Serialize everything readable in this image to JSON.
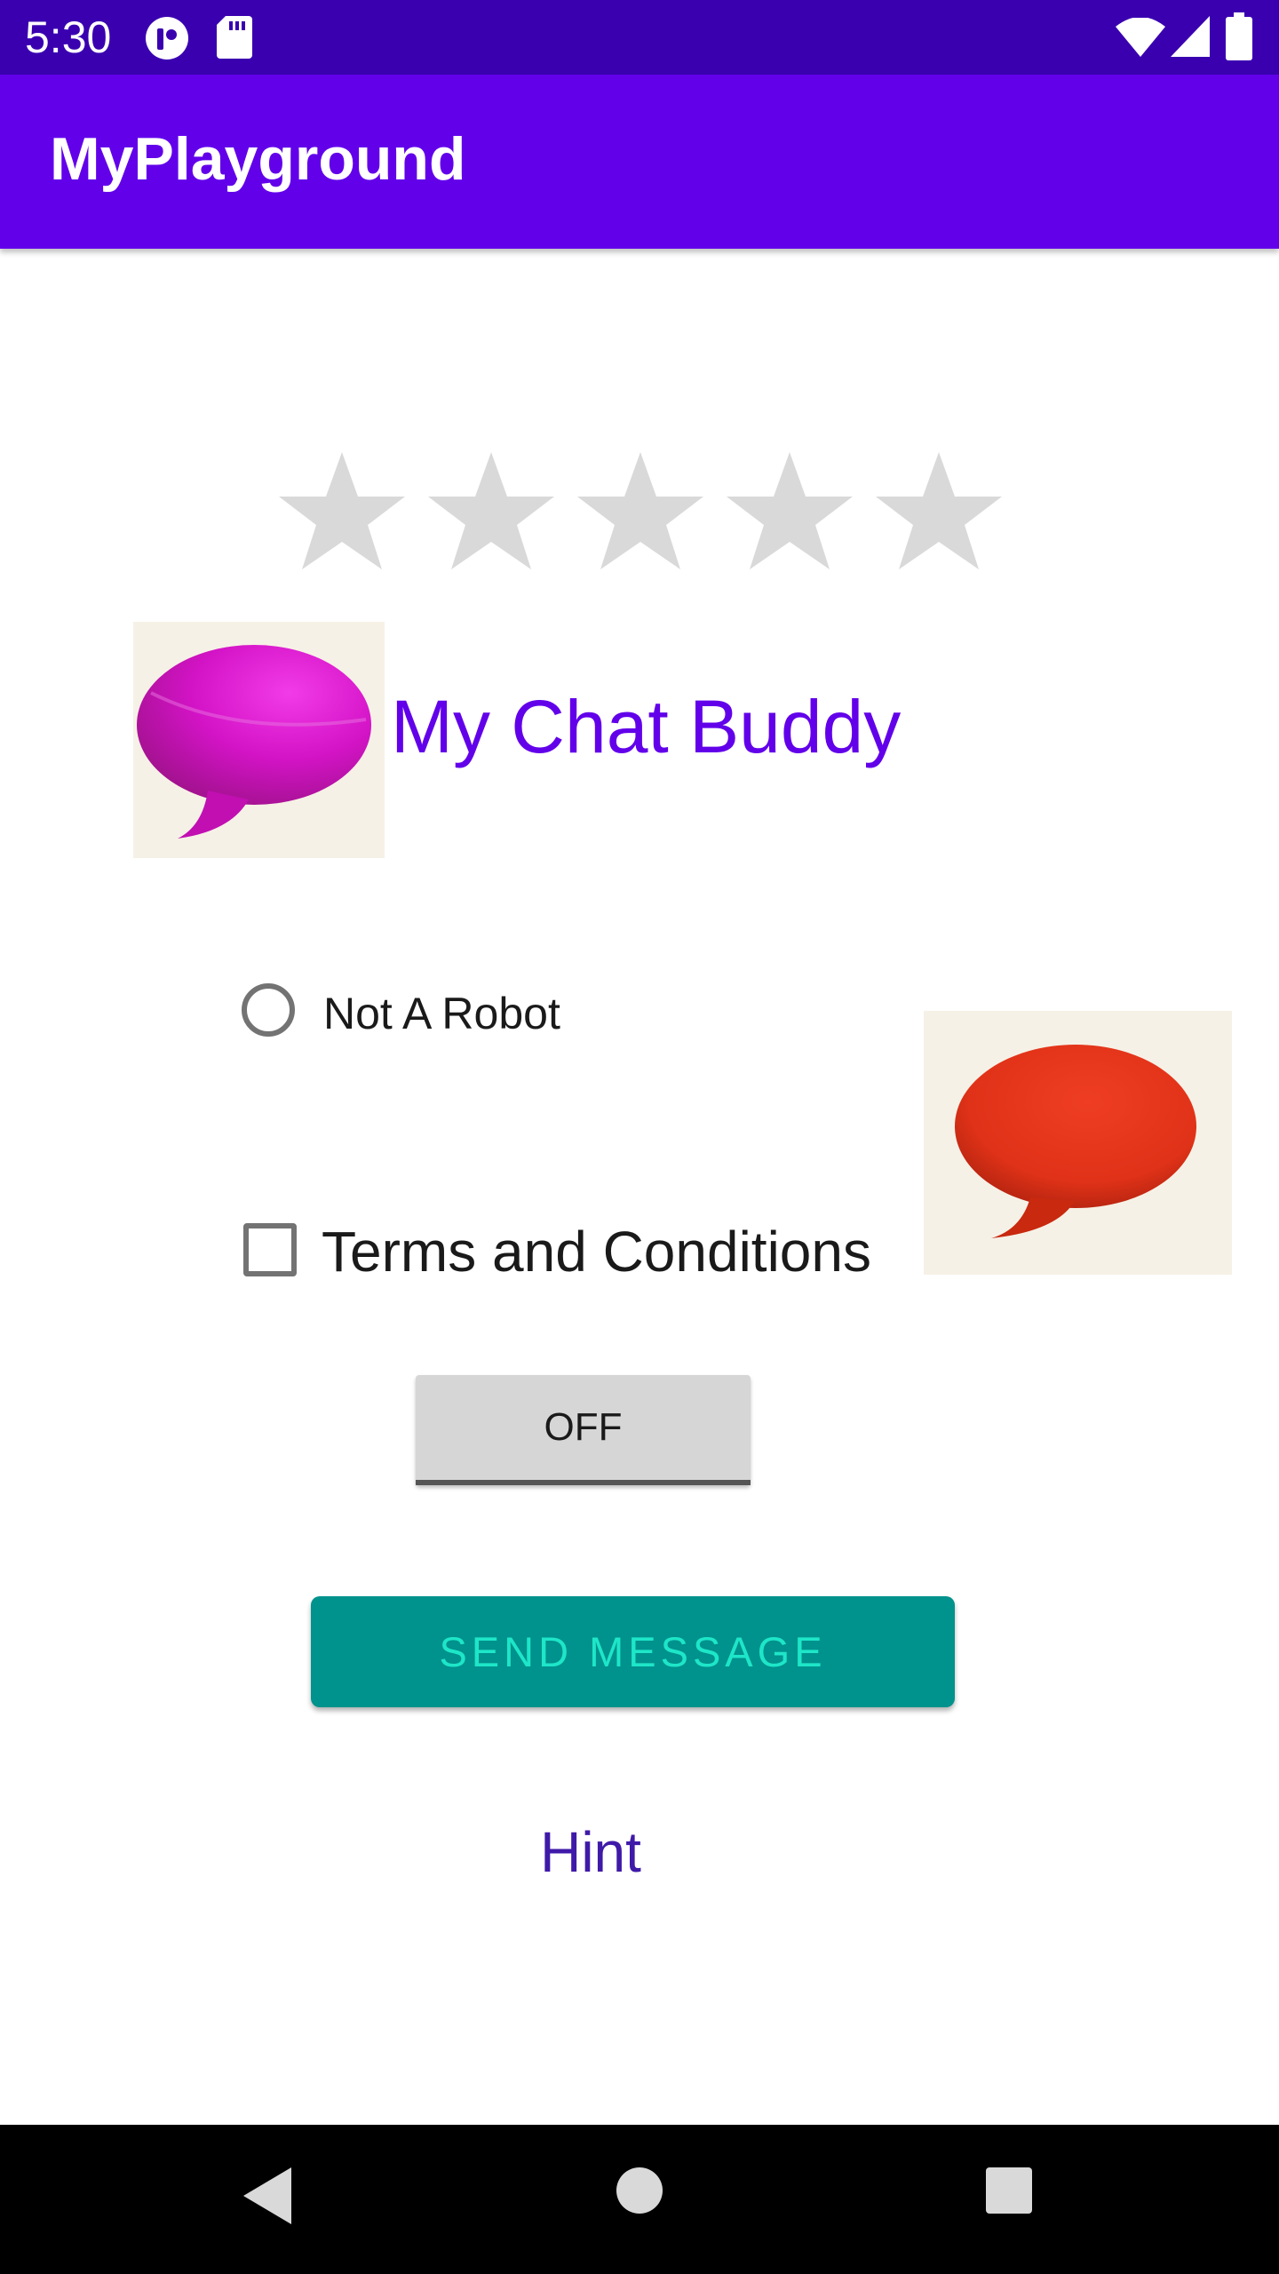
{
  "status_bar": {
    "time": "5:30",
    "icons": [
      "app-notification-icon",
      "sd-card-icon",
      "wifi-icon",
      "cellular-signal-icon",
      "battery-icon"
    ],
    "background_color": "#3a00b0"
  },
  "app_bar": {
    "title": "MyPlayground",
    "background_color": "#6200ea"
  },
  "rating": {
    "max": 5,
    "value": 0,
    "star_color": "#d9d9d9"
  },
  "chat_buddy": {
    "title": "My Chat Buddy",
    "image_icon": "magenta-speech-bubble-icon",
    "title_color": "#6200ea"
  },
  "radio": {
    "label": "Not A Robot",
    "checked": false
  },
  "side_image": {
    "icon": "red-speech-bubble-icon"
  },
  "checkbox": {
    "label": "Terms and Conditions",
    "checked": false
  },
  "toggle": {
    "label": "OFF",
    "state": "off"
  },
  "send_button": {
    "label": "SEND MESSAGE",
    "background_color": "#00928d",
    "text_color": "#1ee6c8"
  },
  "hint": {
    "text": "Hint",
    "color": "#3f1aa8"
  },
  "nav_bar": {
    "buttons": [
      "back-icon",
      "home-icon",
      "recents-icon"
    ]
  }
}
